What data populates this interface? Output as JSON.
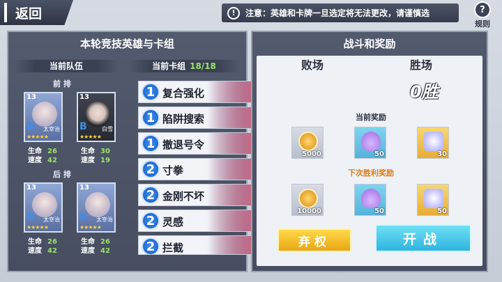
{
  "topbar": {
    "back_label": "返回",
    "notice_icon": "!",
    "notice_text": "注意：英雄和卡牌一旦选定将无法更改，请谨慎选",
    "help_icon": "?",
    "help_label": "规则"
  },
  "left_panel": {
    "title": "本轮竞技英雄与卡组",
    "team_header": "当前队伍",
    "deck_header": "当前卡组",
    "deck_count": "18/18",
    "front_label": "前 排",
    "back_label": "后 排",
    "stat_hp_label": "生命",
    "stat_speed_label": "速度",
    "heroes": [
      {
        "level": "13",
        "name": "太宰治",
        "badge": "B",
        "stars": "★★★★★",
        "hp": "26",
        "speed": "42"
      },
      {
        "level": "13",
        "name": "白雪",
        "badge": "B",
        "stars": "★★★★★",
        "hp": "30",
        "speed": "19"
      },
      {
        "level": "13",
        "name": "太宰治",
        "badge": "B",
        "stars": "★★★★★",
        "hp": "26",
        "speed": "42"
      },
      {
        "level": "13",
        "name": "太宰治",
        "badge": "B",
        "stars": "★★★★★",
        "hp": "26",
        "speed": "42"
      }
    ],
    "cards": [
      {
        "cost": "1",
        "name": "复合强化"
      },
      {
        "cost": "1",
        "name": "陷阱搜索"
      },
      {
        "cost": "1",
        "name": "撤退号令"
      },
      {
        "cost": "2",
        "name": "寸拳"
      },
      {
        "cost": "2",
        "name": "金刚不坏"
      },
      {
        "cost": "2",
        "name": "灵感"
      },
      {
        "cost": "2",
        "name": "拦截"
      }
    ]
  },
  "right_panel": {
    "title": "战斗和奖励",
    "losses_header": "败场",
    "wins_header": "胜场",
    "wins_value": "0胜",
    "current_reward_label": "当前奖励",
    "next_reward_label": "下次胜利奖励",
    "current_rewards": [
      {
        "icon": "coin-icon",
        "qty": "5000"
      },
      {
        "icon": "powder-icon",
        "qty": "50"
      },
      {
        "icon": "gift-icon",
        "qty": "30"
      }
    ],
    "next_rewards": [
      {
        "icon": "coin-icon",
        "qty": "10000"
      },
      {
        "icon": "powder-icon",
        "qty": "50"
      },
      {
        "icon": "gift-icon",
        "qty": "50"
      }
    ],
    "forfeit_label": "弃权",
    "battle_label": "开战"
  },
  "colors": {
    "accent_green": "#9be36a",
    "next_reward_orange": "#e07b12",
    "card_cost_blue": "#1a5bc2",
    "forfeit_yellow": "#e9a614",
    "battle_cyan": "#2fb4e0"
  }
}
